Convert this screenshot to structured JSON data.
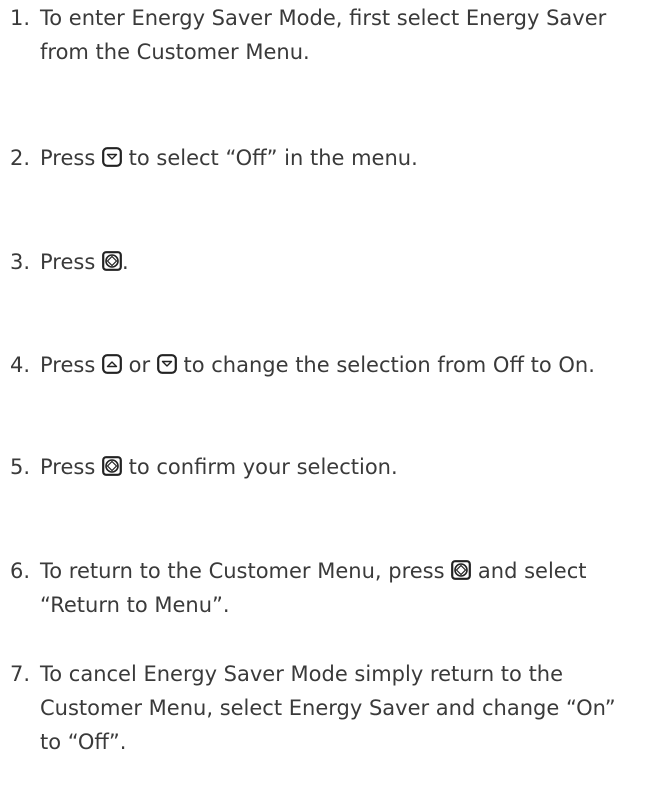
{
  "steps": [
    {
      "num": "1.",
      "lines": [
        "To enter Energy Saver Mode, first select Energy Saver",
        "from the Customer Menu."
      ]
    },
    {
      "num": "2.",
      "before": "Press ",
      "after": " to select “Off” in the menu."
    },
    {
      "num": "3.",
      "before": "Press ",
      "after": "."
    },
    {
      "num": "4.",
      "before": "Press ",
      "middle": " or ",
      "after": " to change the selection from Off to On."
    },
    {
      "num": "5.",
      "before": "Press ",
      "after": " to confirm your selection."
    },
    {
      "num": "6.",
      "before": "To return to the Customer Menu, press ",
      "after": " and select",
      "line2": "“Return to Menu”."
    },
    {
      "num": "7.",
      "lines": [
        "To cancel Energy Saver Mode simply return to the",
        "Customer Menu, select Energy Saver and change “On”",
        "to “Off”."
      ]
    }
  ],
  "icons": {
    "up": "arrow-up-button-icon",
    "down": "arrow-down-button-icon",
    "select": "select-button-icon"
  }
}
